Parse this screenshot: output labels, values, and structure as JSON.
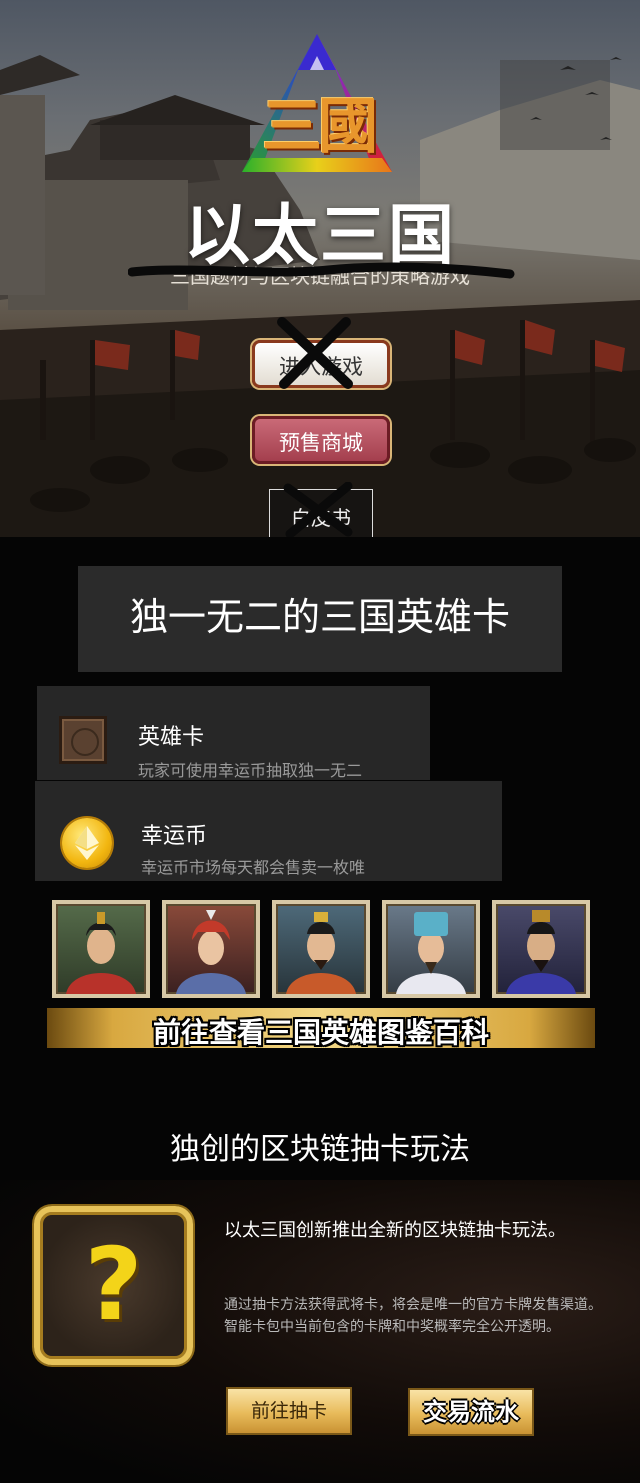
{
  "hero": {
    "logo_char": "三國",
    "title": "以太三国",
    "subtitle": "三国题材与区块链融合的策略游戏",
    "buttons": {
      "enter_game": "进入游戏",
      "presale_store": "预售商城",
      "whitepaper": "白皮书"
    }
  },
  "features": {
    "heading": "独一无二的三国英雄卡",
    "items": [
      {
        "title": "英雄卡",
        "desc": "玩家可使用幸运币抽取独一无二",
        "icon": "hero-card-icon"
      },
      {
        "title": "幸运币",
        "desc": "幸运币市场每天都会售卖一枚唯",
        "icon": "ether-coin-icon"
      }
    ]
  },
  "heroes_gallery": {
    "portraits": [
      "hero-portrait-1",
      "hero-portrait-2",
      "hero-portrait-3",
      "hero-portrait-4",
      "hero-portrait-5"
    ],
    "banner_label": "前往查看三国英雄图鉴百科"
  },
  "draw_section": {
    "heading": "独创的区块链抽卡玩法",
    "lead": "以太三国创新推出全新的区块链抽卡玩法。",
    "paragraph_1": "通过抽卡方法获得武将卡，将会是唯一的官方卡牌发售渠道。",
    "paragraph_2": "智能卡包中当前包含的卡牌和中奖概率完全公开透明。",
    "draw_button": "前往抽卡",
    "trade_button": "交易流水",
    "mystery_symbol": "?"
  },
  "colors": {
    "gold": "#e7c35a",
    "presale_red": "#b24a59",
    "panel_gray": "#2b2b2b"
  }
}
